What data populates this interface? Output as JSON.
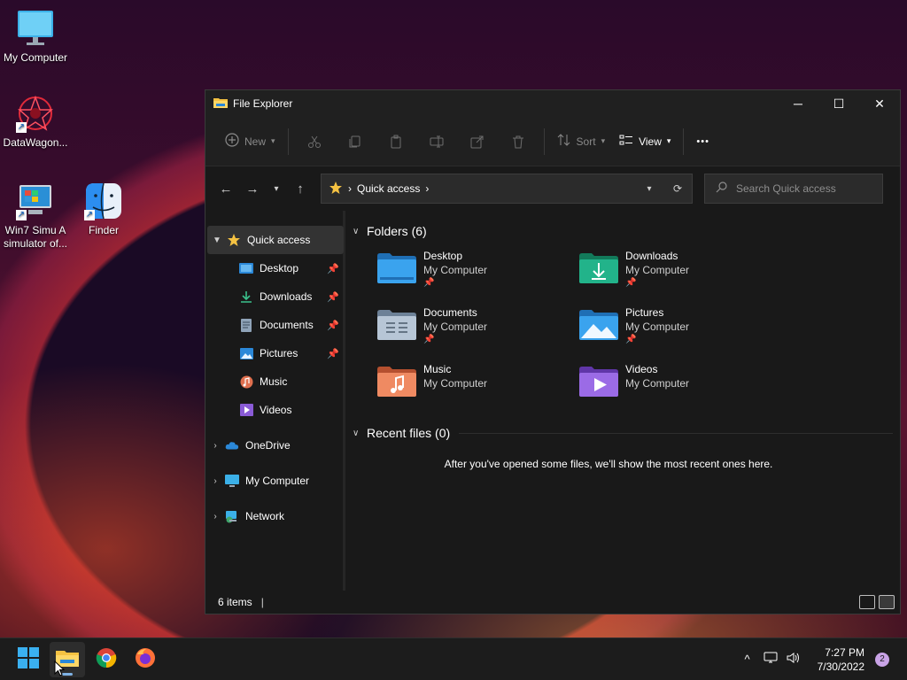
{
  "desktop": {
    "icons": [
      {
        "label": "My Computer",
        "icon": "monitor-icon"
      },
      {
        "label": "DataWagon...",
        "icon": "datawagon-icon",
        "shortcut": true
      },
      {
        "label": "Win7 Simu  A simulator of...",
        "icon": "win7-simulator-icon",
        "shortcut": true
      },
      {
        "label": "Finder",
        "icon": "finder-icon",
        "shortcut": true
      }
    ]
  },
  "window": {
    "title": "File Explorer",
    "controls": {
      "minimize": "─",
      "maximize": "☐",
      "close": "✕"
    },
    "toolbar": {
      "new_label": "New",
      "sort_label": "Sort",
      "view_label": "View",
      "more_label": "•••"
    },
    "address": {
      "path": "Quick access",
      "separator": "›"
    },
    "search": {
      "placeholder": "Search Quick access",
      "value": ""
    },
    "nav": {
      "quick_access": "Quick access",
      "pinned": [
        {
          "label": "Desktop",
          "icon": "desktop-folder-icon",
          "pinned": true
        },
        {
          "label": "Downloads",
          "icon": "downloads-icon",
          "pinned": true
        },
        {
          "label": "Documents",
          "icon": "documents-icon",
          "pinned": true
        },
        {
          "label": "Pictures",
          "icon": "pictures-icon",
          "pinned": true
        },
        {
          "label": "Music",
          "icon": "music-icon",
          "pinned": false
        },
        {
          "label": "Videos",
          "icon": "videos-icon",
          "pinned": false
        }
      ],
      "onedrive": "OneDrive",
      "my_computer": "My Computer",
      "network": "Network"
    },
    "folders_header": "Folders (6)",
    "folders": [
      {
        "name": "Desktop",
        "location": "My Computer",
        "pinned": true,
        "color": "#2b88d8"
      },
      {
        "name": "Downloads",
        "location": "My Computer",
        "pinned": true,
        "color": "#1fa27a"
      },
      {
        "name": "Documents",
        "location": "My Computer",
        "pinned": true,
        "color": "#8fa3b8"
      },
      {
        "name": "Pictures",
        "location": "My Computer",
        "pinned": true,
        "color": "#2b88d8"
      },
      {
        "name": "Music",
        "location": "My Computer",
        "pinned": false,
        "color": "#e0704f"
      },
      {
        "name": "Videos",
        "location": "My Computer",
        "pinned": false,
        "color": "#8a5bd6"
      }
    ],
    "recent_header": "Recent files (0)",
    "recent_empty": "After you've opened some files, we'll show the most recent ones here.",
    "status": {
      "items": "6 items",
      "divider": "|"
    }
  },
  "taskbar": {
    "apps": [
      "start-icon",
      "file-explorer-icon",
      "chrome-icon",
      "firefox-icon"
    ],
    "time": "7:27 PM",
    "date": "7/30/2022",
    "notifications": "2",
    "tray_chevron": "^"
  },
  "colors": {
    "accent": "#60cdff",
    "window_bg": "#191919",
    "selected": "#333333"
  }
}
